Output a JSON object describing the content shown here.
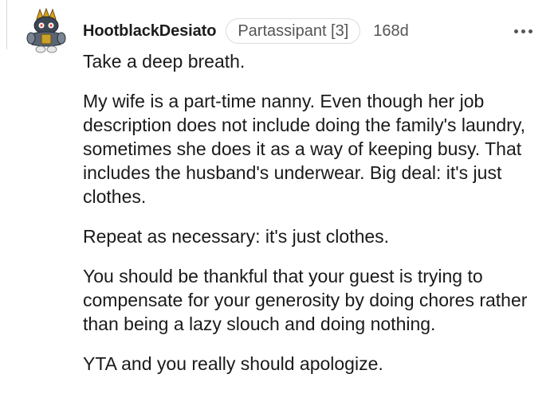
{
  "comment": {
    "author": "HootblackDesiato",
    "flair": "Partassipant [3]",
    "age": "168d",
    "avatar_icon": "snoo-avatar-icon",
    "more_icon": "more-options-icon",
    "paragraphs": [
      "Take a deep breath.",
      "My wife is a part-time nanny. Even though her job description does not include doing the family's laundry, sometimes she does it as a way of keeping busy. That includes the husband's underwear. Big deal: it's just clothes.",
      "Repeat as necessary: it's just clothes.",
      "You should be thankful that your guest is trying to compensate for your generosity by doing chores rather than being a lazy slouch and doing nothing.",
      "YTA and you really should apologize."
    ]
  }
}
